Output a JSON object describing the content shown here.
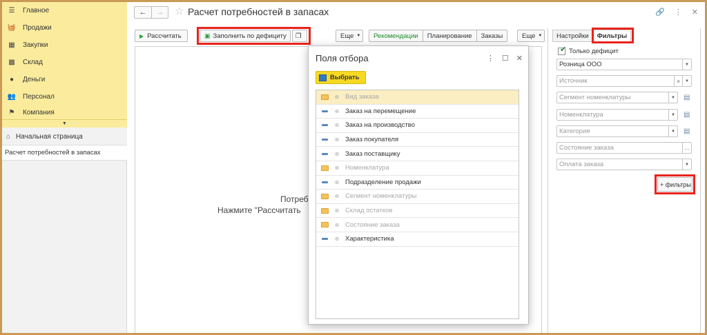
{
  "sidebar": {
    "sections": [
      {
        "icon": "menu-icon",
        "label": "Главное"
      },
      {
        "icon": "shopping-basket-icon",
        "label": "Продажи"
      },
      {
        "icon": "purchases-icon",
        "label": "Закупки"
      },
      {
        "icon": "warehouse-icon",
        "label": "Склад"
      },
      {
        "icon": "money-icon",
        "label": "Деньги"
      },
      {
        "icon": "personnel-icon",
        "label": "Персонал"
      },
      {
        "icon": "flag-icon",
        "label": "Компания"
      }
    ],
    "home_label": "Начальная страница",
    "open_window": "Расчет потребностей в запасах"
  },
  "header": {
    "title": "Расчет потребностей в запасах"
  },
  "toolbar": {
    "calculate": "Рассчитать",
    "fill_deficit": "Заполнить по дефициту",
    "more": "Еще",
    "tabs": [
      "Рекомендации",
      "Планирование",
      "Заказы"
    ],
    "more2": "Еще"
  },
  "work": {
    "message_line1": "Потреб",
    "message_line2": "Нажмите \"Рассчитать"
  },
  "right_panel": {
    "tab_settings": "Настройки",
    "tab_filters": "Фильтры",
    "only_deficit": "Только дефицит",
    "org_value": "Розница ООО",
    "placeholders": {
      "source": "Источник",
      "segment": "Сегмент номенклатуры",
      "nomenclature": "Номенклатура",
      "category": "Категория",
      "order_state": "Состояние заказа",
      "order_payment": "Оплата заказа"
    },
    "add_filters": "+ фильтры"
  },
  "dialog": {
    "title": "Поля отбора",
    "pick": "Выбрать",
    "fields": [
      {
        "label": "Вид заказа",
        "type": "folder",
        "enabled": false,
        "selected": true
      },
      {
        "label": "Заказ на перемещение",
        "type": "field",
        "enabled": true
      },
      {
        "label": "Заказ на производство",
        "type": "field",
        "enabled": true
      },
      {
        "label": "Заказ покупателя",
        "type": "field",
        "enabled": true
      },
      {
        "label": "Заказ поставщику",
        "type": "field",
        "enabled": true
      },
      {
        "label": "Номенклатура",
        "type": "folder",
        "enabled": false
      },
      {
        "label": "Подразделение продажи",
        "type": "field",
        "enabled": true
      },
      {
        "label": "Сегмент номенклатуры",
        "type": "folder",
        "enabled": false
      },
      {
        "label": "Склад остатков",
        "type": "folder",
        "enabled": false
      },
      {
        "label": "Состояние заказа",
        "type": "folder",
        "enabled": false
      },
      {
        "label": "Характеристика",
        "type": "field",
        "enabled": true
      }
    ]
  },
  "colors": {
    "section_bg": "#fbec9d",
    "highlight": "#e8231b",
    "active_tab": "#1e8a2c",
    "pick_button": "#f7d924",
    "selected_row": "#fbeec2"
  }
}
